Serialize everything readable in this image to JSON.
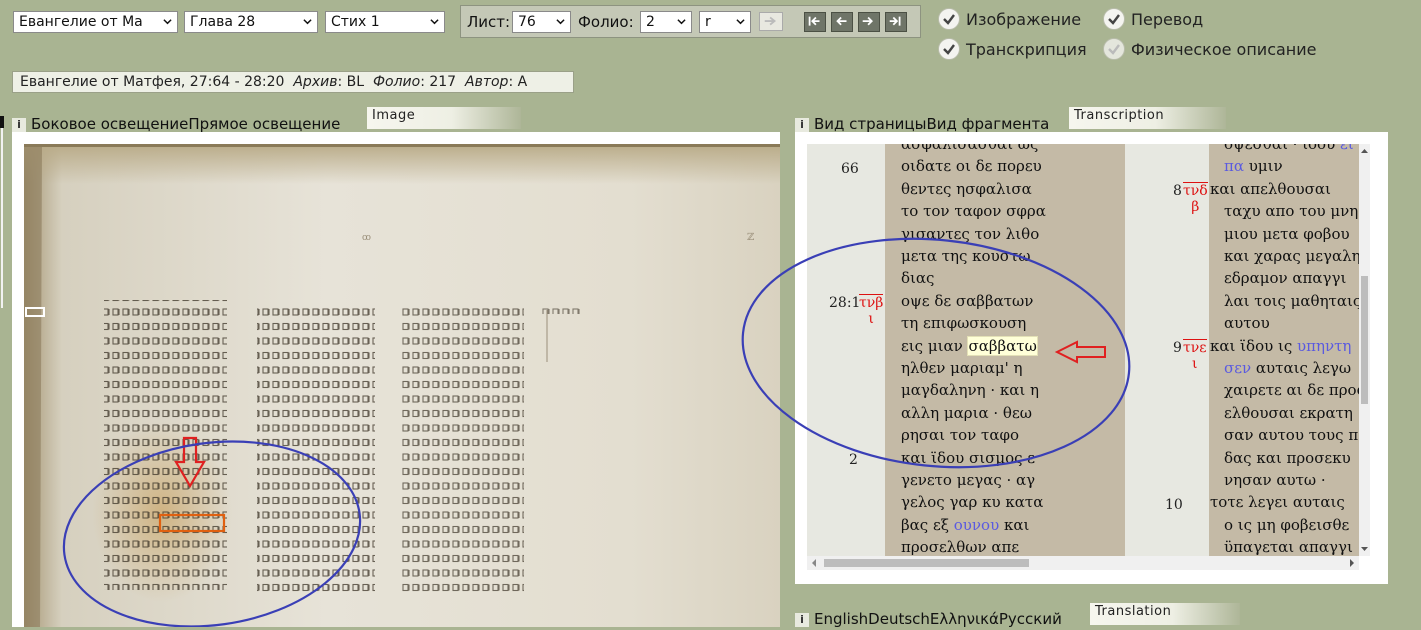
{
  "nav": {
    "book": "Евангелие от Ма",
    "chapter": "Глава 28",
    "verse": "Стих 1",
    "list_label": "Лист:",
    "list_value": "76",
    "folio_label": "Фолио:",
    "folio_value": "2",
    "side_value": "r"
  },
  "toggles": {
    "image": "Изображение",
    "transcription": "Транскрипция",
    "translation": "Перевод",
    "physical": "Физическое описание"
  },
  "info": {
    "location": "Евангелие от Матфея, 27:64 - 28:20",
    "archive_label": "Архив",
    "archive_value": "BL",
    "folio_label": "Фолио",
    "folio_value": "217",
    "author_label": "Автор",
    "author_value": "A"
  },
  "image_panel": {
    "info_badge": "i",
    "tab1": "Боковое освещение",
    "tab2": "Прямое освещение",
    "title": "Image"
  },
  "transcription_panel": {
    "info_badge": "i",
    "tab1": "Вид страницы",
    "tab2": "Вид фрагмента",
    "title": "Transcription",
    "col1_numbers": [
      "66",
      "28:1",
      "2"
    ],
    "col2_numbers": [
      "8",
      "9",
      "10"
    ],
    "col1_marks": [
      {
        "top": "τνβ",
        "bottom": "ι"
      }
    ],
    "col2_marks": [
      {
        "top": "τνδ",
        "bottom": "β"
      },
      {
        "top": "τνε",
        "bottom": "ι"
      }
    ],
    "col1_lines": [
      "ασφαλισασθαι ως",
      "οιδατε οι δε πορευ",
      "θεντες ησφαλισα",
      "το τον ταφον σφρα",
      "γισαντες τον λιθο",
      "μετα της κουστω",
      "διας",
      "οψε δε σαββατων",
      "τη επιφωσκουση",
      "εις μιαν ",
      "σαββατω",
      "ηλθεν μαριαμ' η",
      "μαγδαληνη · και η",
      "αλλη μαρια · θεω",
      "ρησαι τον ταφο",
      "και ϊδου σισμος ε",
      "γενετο μεγας · αγ",
      "γελος γαρ κυ κατα",
      "βας εξ ",
      "ουνου",
      " και",
      "προσελθων απε"
    ],
    "col2_lines": [
      "οψεσθαι · ιδου ",
      "ει",
      "πα",
      " υμιν",
      "και απελθουσαι",
      "ταχυ απο του μνη",
      "μιου μετα φοβου",
      "και χαρας μεγαλη",
      "εδραμον απαγγι",
      "λαι τοις μαθηταις",
      "αυτου",
      "και ϊδου ις ",
      "υπηντη",
      "σεν",
      " αυταις λεγω",
      "χαιρετε αι δε προσ",
      "ελθουσαι εκρατη",
      "σαν αυτου τους πο",
      "δας και προσεκυ",
      "νησαν αυτω ·",
      "τοτε λεγει αυταις",
      "ο ις μη φοβεισθε",
      "ϋπαγεται απαγγι"
    ]
  },
  "translation_panel": {
    "info_badge": "i",
    "lang1": "English",
    "lang2": "Deutsch",
    "lang3": "Ελληνικά",
    "lang4": "Русский",
    "title": "Translation"
  },
  "colors": {
    "background": "#a9b492",
    "annotation_circle": "#3a3fb6",
    "annotation_arrow": "#e02020",
    "highlight_box": "#e06010",
    "parchment_column": "#c4baa6"
  },
  "icons": [
    "chevron-down-icon",
    "arrow-right-icon",
    "first-page-icon",
    "prev-page-icon",
    "next-page-icon",
    "last-page-icon",
    "check-icon",
    "info-icon"
  ]
}
